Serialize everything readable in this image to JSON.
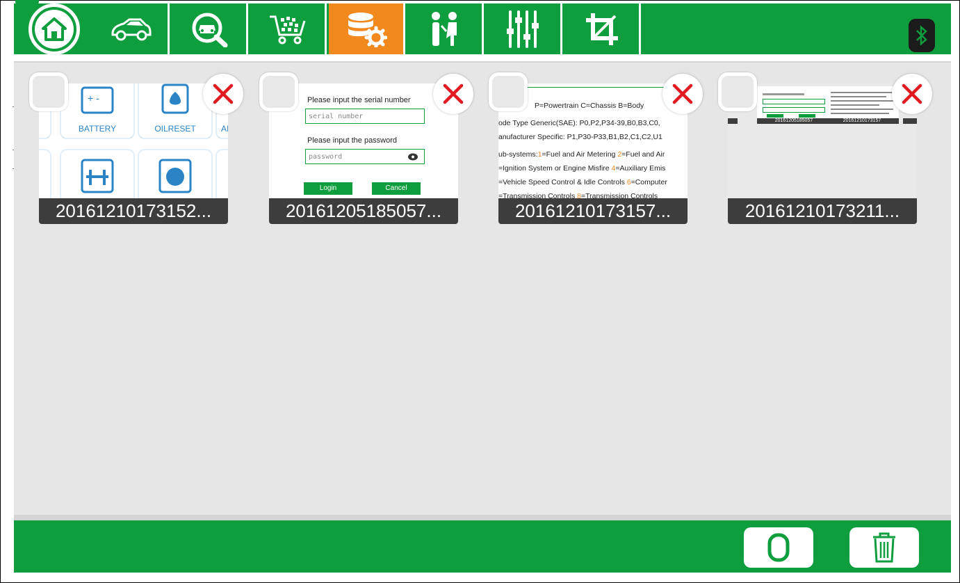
{
  "toolbar": {
    "tabs": [
      {
        "icon": "home-icon"
      },
      {
        "icon": "car-icon"
      },
      {
        "icon": "car-search-icon"
      },
      {
        "icon": "shopping-cart-icon"
      },
      {
        "icon": "database-settings-icon",
        "active": true
      },
      {
        "icon": "people-icon"
      },
      {
        "icon": "sliders-icon"
      },
      {
        "icon": "crop-icon"
      }
    ],
    "bluetooth_icon": "bluetooth-icon"
  },
  "colors": {
    "primary": "#0f9e3e",
    "active_tab": "#f2891f",
    "remove": "#e21b23",
    "content_bg": "#e6e6e6"
  },
  "screenshots": [
    {
      "caption": "20161210173152...",
      "preview": {
        "tiles": [
          "BATTERY",
          "OILRESET",
          "AI"
        ]
      }
    },
    {
      "caption": "20161205185057...",
      "preview": {
        "serial_prompt": "Please input the serial number",
        "serial_placeholder": "serial number",
        "password_prompt": "Please input the password",
        "password_placeholder": "password",
        "login_label": "Login",
        "cancel_label": "Cancel"
      }
    },
    {
      "caption": "20161210173157...",
      "preview": {
        "line1": "P=Powertrain  C=Chassis  B=Body",
        "line2": "ode Type Generic(SAE):  P0,P2,P34-39,B0,B3,C0,",
        "line3": "anufacturer Specific:  P1,P30-P33,B1,B2,C1,C2,U1",
        "line4a": "ub-systems:",
        "line4b": "1",
        "line4c": "=Fuel and Air Metering ",
        "line4d": "2",
        "line4e": "=Fuel and Air",
        "line5a": "=Ignition System or Engine Misfire ",
        "line5b": "4",
        "line5c": "=Auxiliary Emis",
        "line6a": "=Vehicle Speed Control & Idle Controls ",
        "line6b": "6",
        "line6c": "=Computer",
        "line7a": "=Transmission Controls ",
        "line7b": "8",
        "line7c": "=Transmission Controls"
      }
    },
    {
      "caption": "20161210173211...",
      "preview": {
        "mini_captions": [
          "20161205185057",
          "20161210173157"
        ]
      }
    }
  ],
  "bottom": {
    "select_all_icon": "circle-o-icon",
    "delete_icon": "trash-icon"
  }
}
